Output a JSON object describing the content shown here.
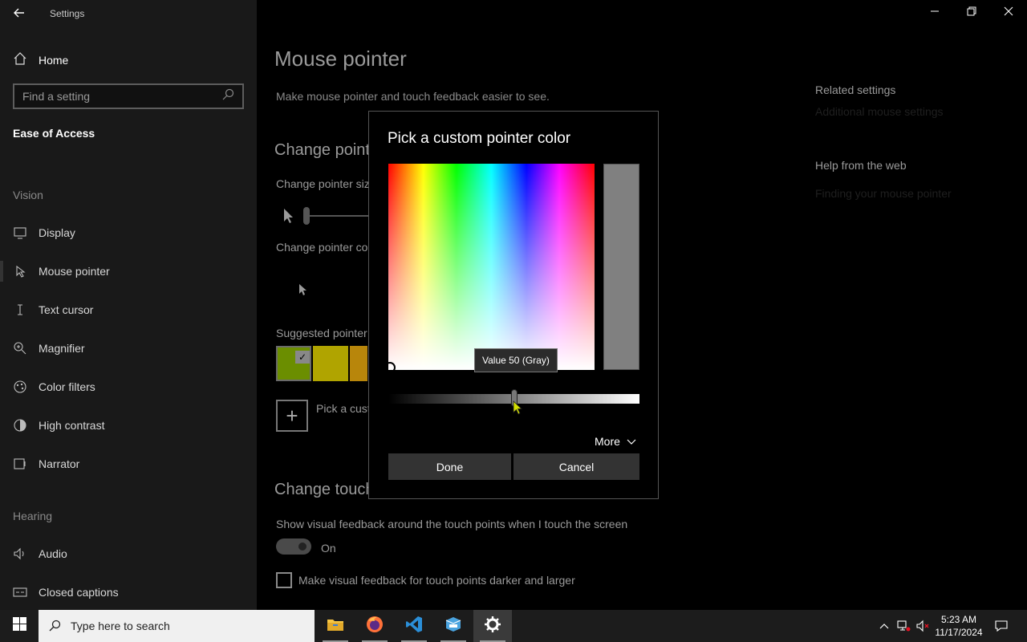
{
  "app": {
    "title": "Settings"
  },
  "sidebar": {
    "home": "Home",
    "search_placeholder": "Find a setting",
    "section": "Ease of Access",
    "groups": {
      "vision": "Vision",
      "hearing": "Hearing"
    },
    "vision_items": [
      {
        "label": "Display",
        "icon": "monitor-icon"
      },
      {
        "label": "Mouse pointer",
        "icon": "mouse-pointer-icon"
      },
      {
        "label": "Text cursor",
        "icon": "text-cursor-icon"
      },
      {
        "label": "Magnifier",
        "icon": "magnifier-icon"
      },
      {
        "label": "Color filters",
        "icon": "color-filters-icon"
      },
      {
        "label": "High contrast",
        "icon": "high-contrast-icon"
      },
      {
        "label": "Narrator",
        "icon": "narrator-icon"
      }
    ],
    "hearing_items": [
      {
        "label": "Audio",
        "icon": "speaker-icon"
      },
      {
        "label": "Closed captions",
        "icon": "closed-captions-icon"
      }
    ]
  },
  "main": {
    "title": "Mouse pointer",
    "description": "Make mouse pointer and touch feedback easier to see.",
    "change_pointer_heading": "Change point",
    "change_pointer_size": "Change pointer siz",
    "change_pointer_color": "Change pointer co",
    "suggested": "Suggested pointer",
    "swatch_colors": [
      "#6b8e00",
      "#b0a400",
      "#b8860b"
    ],
    "pick_custom": "Pick a cust",
    "change_touch_heading": "Change touch",
    "touch_desc": "Show visual feedback around the touch points when I touch the screen",
    "toggle_state": "On",
    "darker_label": "Make visual feedback for touch points darker and larger",
    "related_heading": "Related settings",
    "related_link": "Additional mouse settings",
    "help_heading": "Help from the web",
    "help_link": "Finding your mouse pointer"
  },
  "dialog": {
    "title": "Pick a custom pointer color",
    "tooltip": "Value 50 (Gray)",
    "value_percent": 50,
    "preview_color": "#808080",
    "more": "More",
    "done": "Done",
    "cancel": "Cancel"
  },
  "taskbar": {
    "search_placeholder": "Type here to search",
    "apps": [
      "file-explorer-icon",
      "firefox-icon",
      "vscode-icon",
      "sandbox-icon",
      "settings-gear-icon"
    ],
    "time": "5:23 AM",
    "date": "11/17/2024"
  }
}
